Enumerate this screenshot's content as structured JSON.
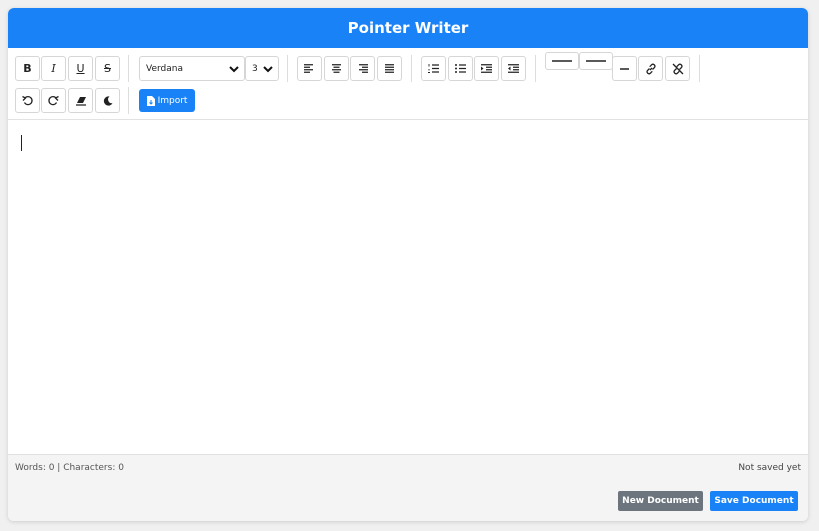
{
  "app": {
    "title": "Pointer Writer"
  },
  "toolbar": {
    "format_buttons": [
      {
        "name": "bold",
        "glyph": "B"
      },
      {
        "name": "italic",
        "glyph": "I"
      },
      {
        "name": "underline",
        "glyph": "U"
      },
      {
        "name": "strikethrough",
        "glyph": "S"
      }
    ],
    "font_family": {
      "selected": "Verdana"
    },
    "font_size": {
      "selected": "3"
    },
    "align_icons": [
      "align-left-icon",
      "align-center-icon",
      "align-right-icon",
      "align-justify-icon"
    ],
    "list_icons": [
      "ordered-list-icon",
      "unordered-list-icon",
      "indent-icon",
      "outdent-icon"
    ],
    "insert_icons": [
      "horizontal-rule-icon",
      "horizontal-rule-alt-icon",
      "dash-icon",
      "link-icon",
      "unlink-icon"
    ],
    "history_icons": [
      "undo-icon",
      "redo-icon",
      "eraser-icon",
      "dark-mode-icon"
    ],
    "import_label": "Import"
  },
  "footer": {
    "stats": "Words: 0 | Characters: 0",
    "save_status": "Not saved yet",
    "new_document_label": "New Document",
    "save_document_label": "Save Document"
  },
  "colors": {
    "primary": "#1a82f7",
    "secondary": "#6c757d"
  }
}
